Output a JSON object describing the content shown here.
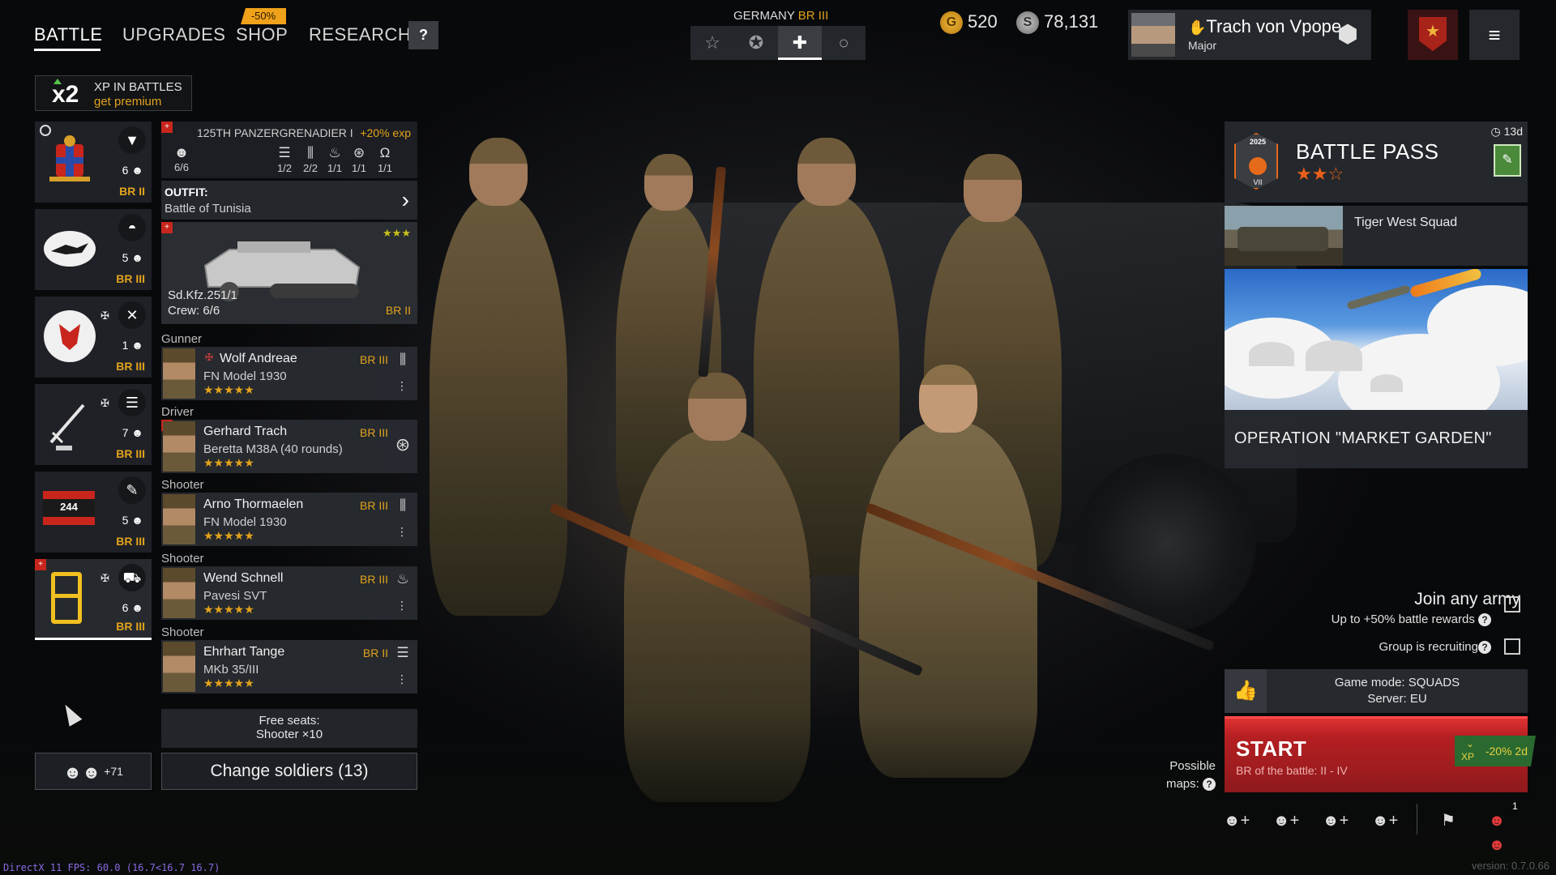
{
  "nav": {
    "tabs": [
      {
        "label": "BATTLE"
      },
      {
        "label": "UPGRADES"
      },
      {
        "label": "SHOP"
      },
      {
        "label": "RESEARCH"
      }
    ],
    "shop_sale": "-50%",
    "help_label": "?"
  },
  "xp_promo": {
    "multiplier": "x2",
    "line1": "XP IN BATTLES",
    "line2": "get premium"
  },
  "squads": [
    {
      "count": "6",
      "br": "BR II",
      "type_icon": "paratrooper-icon"
    },
    {
      "count": "5",
      "br": "BR III",
      "type_icon": "tanker-icon"
    },
    {
      "count": "1",
      "br": "BR III",
      "type_icon": "pilot-icon"
    },
    {
      "count": "7",
      "br": "BR III",
      "type_icon": "assault-icon"
    },
    {
      "count": "5",
      "br": "BR III",
      "type_icon": "engineer-icon",
      "emblem_text": "244"
    },
    {
      "count": "6",
      "br": "BR III",
      "type_icon": "vehicle-icon",
      "emblem_text": "B"
    }
  ],
  "squad_detail": {
    "name": "125TH PANZERGRENADIER I",
    "bonus": "+20% exp",
    "crew": "6/6",
    "slots": [
      "1/2",
      "2/2",
      "1/1",
      "1/1",
      "1/1"
    ],
    "outfit_label": "OUTFIT:",
    "outfit_value": "Battle of Tunisia",
    "vehicle": {
      "name": "Sd.Kfz.251/1",
      "crew": "Crew: 6/6",
      "br": "BR II",
      "stars": "★★★"
    },
    "soldiers": [
      {
        "role": "Gunner",
        "name": "Wolf Andreae",
        "weapon": "FN Model 1930",
        "br": "BR III",
        "stars": "★★★★★"
      },
      {
        "role": "Driver",
        "name": "Gerhard Trach",
        "weapon": "Beretta M38A (40 rounds)",
        "br": "BR III",
        "stars": "★★★★★"
      },
      {
        "role": "Shooter",
        "name": "Arno Thormaelen",
        "weapon": "FN Model 1930",
        "br": "BR III",
        "stars": "★★★★★"
      },
      {
        "role": "Shooter",
        "name": "Wend Schnell",
        "weapon": "Pavesi SVT",
        "br": "BR III",
        "stars": "★★★★★"
      },
      {
        "role": "Shooter",
        "name": "Ehrhart Tange",
        "weapon": "MKb 35/III",
        "br": "BR II",
        "stars": "★★★★★"
      }
    ],
    "free_seats_label": "Free seats:",
    "free_seats_value": "Shooter ×10",
    "change_soldiers": "Change soldiers (13)",
    "friends_count": "+71"
  },
  "army": {
    "name": "GERMANY",
    "br": "BR III"
  },
  "currency": {
    "gold": "520",
    "silver": "78,131"
  },
  "profile": {
    "name": "Trach von Vpope",
    "rank": "Major"
  },
  "battle_pass": {
    "title": "BATTLE PASS",
    "timer": "13d",
    "stars": "★★☆",
    "emblem_year": "2025",
    "emblem_level": "VII"
  },
  "promo": {
    "tiger_title": "Tiger West Squad",
    "operation_title": "OPERATION \"MARKET GARDEN\""
  },
  "matchmaking": {
    "join_any_army": "Join any army",
    "join_sub": "Up to +50% battle rewards",
    "group_recruiting": "Group is recruiting",
    "game_mode": "Game mode: SQUADS",
    "server": "Server: EU",
    "start_label": "START",
    "start_sub": "BR of the battle: II - IV",
    "xp_bonus": "-20% 2d",
    "xp_bonus_tag": "XP",
    "possible_maps_line1": "Possible",
    "possible_maps_line2": "maps:",
    "party_count": "1"
  },
  "footer": {
    "fps": "DirectX 11 FPS: 60.0 (16.7<16.7 16.7)",
    "version": "version: 0.7.0.66"
  },
  "colors": {
    "accent_gold": "#e2a31c",
    "start_red": "#b51f22",
    "battle_pass_orange": "#e8601a"
  }
}
